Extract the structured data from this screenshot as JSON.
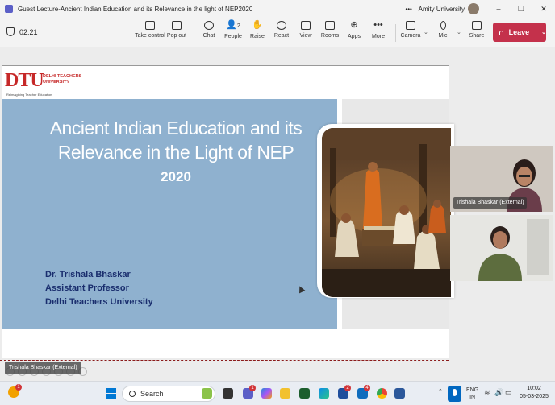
{
  "window": {
    "title": "Guest Lecture-Ancient Indian Education and its Relevance in the light of NEP2020",
    "more": "•••",
    "org": "Amity University",
    "minimize": "–",
    "maximize": "❐",
    "close": "✕"
  },
  "meeting": {
    "timer": "02:21",
    "toolbar": [
      {
        "label": "Take control",
        "icon": "take-control-icon"
      },
      {
        "label": "Pop out",
        "icon": "pop-out-icon"
      },
      {
        "label": "Chat",
        "icon": "chat-icon"
      },
      {
        "label": "People",
        "icon": "people-icon",
        "count": "2"
      },
      {
        "label": "Raise",
        "icon": "raise-hand-icon"
      },
      {
        "label": "React",
        "icon": "react-icon"
      },
      {
        "label": "View",
        "icon": "view-icon"
      },
      {
        "label": "Rooms",
        "icon": "rooms-icon"
      },
      {
        "label": "Apps",
        "icon": "apps-icon"
      },
      {
        "label": "More",
        "icon": "more-icon"
      },
      {
        "label": "Camera",
        "icon": "camera-icon"
      },
      {
        "label": "Mic",
        "icon": "mic-icon"
      },
      {
        "label": "Share",
        "icon": "share-icon"
      }
    ],
    "leave_label": "Leave",
    "accent": "#c4314b"
  },
  "slide": {
    "logo_mark": "DTU",
    "logo_name": "DELHI TEACHERS UNIVERSITY",
    "logo_tagline": "Reimagining Teacher Education",
    "title": "Ancient Indian Education and its Relevance in the Light of NEP",
    "year": "2020",
    "speaker_name": "Dr. Trishala Bhaskar",
    "speaker_role": "Assistant Professor",
    "speaker_org": "Delhi Teachers University",
    "panel_color": "#8fb1cf"
  },
  "presenter_tag": "Trishala Bhaskar (External)",
  "video_tiles": [
    {
      "label": "Trishala Bhaskar (External)"
    },
    {
      "label": ""
    }
  ],
  "taskbar": {
    "weather_badge": "1",
    "search_placeholder": "Search",
    "teams_badge": "1",
    "lync_badge": "2",
    "outlook_badge": "4",
    "lang_line1": "ENG",
    "lang_line2": "IN",
    "time": "10:02",
    "date": "05-03-2025"
  }
}
